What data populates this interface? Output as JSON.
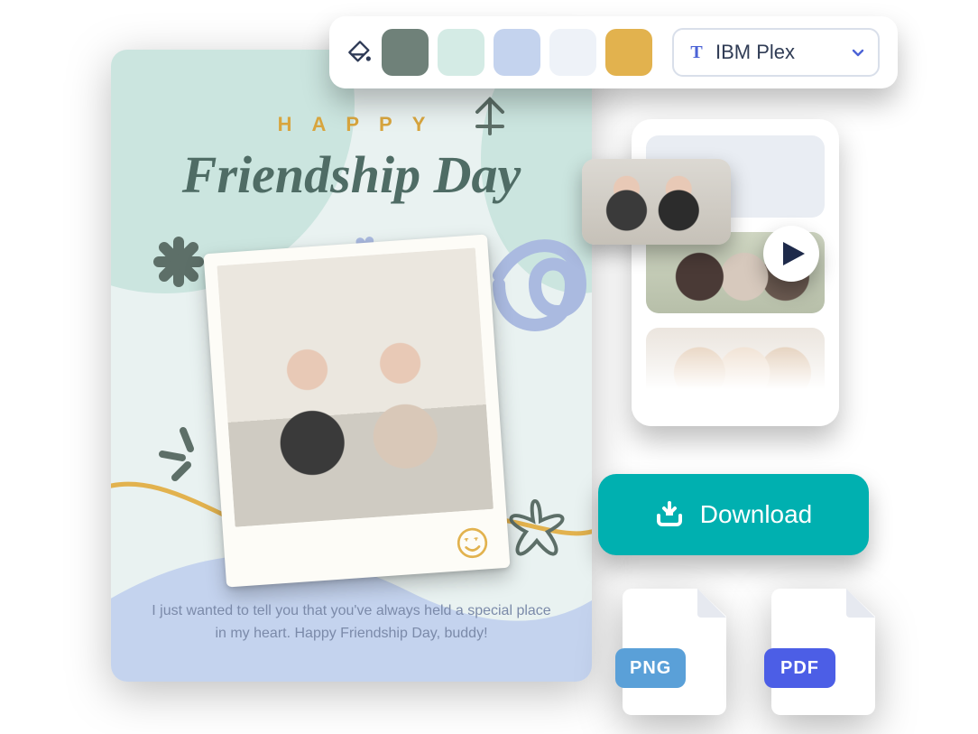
{
  "card": {
    "title_top": "HAPPY",
    "title_script": "Friendship Day",
    "message": "I just wanted to tell you that you've always held a special place in my heart. Happy Friendship Day, buddy!"
  },
  "toolbar": {
    "swatches": [
      "#6f8179",
      "#d4ebe5",
      "#c4d3ee",
      "#eef2f8",
      "#e2b24e"
    ],
    "font_selected": "IBM Plex"
  },
  "media_panel": {
    "thumbs": [
      "blank",
      "group-back",
      "group-smile"
    ]
  },
  "download": {
    "label": "Download"
  },
  "formats": {
    "png": "PNG",
    "pdf": "PDF"
  }
}
